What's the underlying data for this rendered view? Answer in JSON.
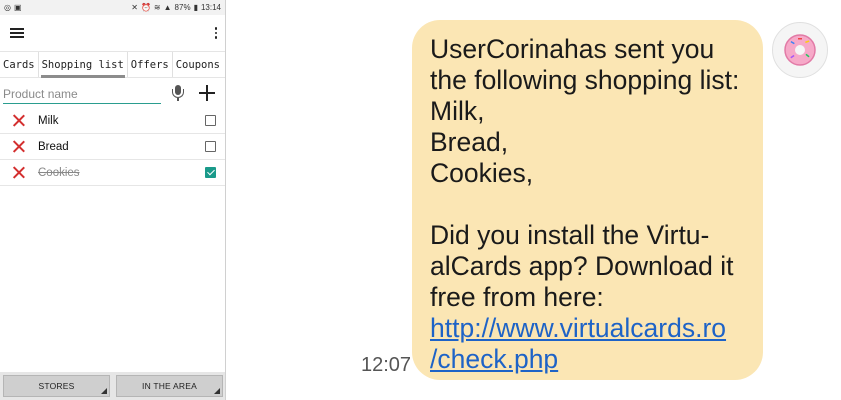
{
  "status_bar": {
    "battery": "87%",
    "time": "13:14"
  },
  "tabs": [
    {
      "label": "Cards"
    },
    {
      "label": "Shopping list"
    },
    {
      "label": "Offers"
    },
    {
      "label": "Coupons"
    }
  ],
  "input": {
    "placeholder": "Product name",
    "value": ""
  },
  "items": [
    {
      "name": "Milk",
      "checked": false
    },
    {
      "name": "Bread",
      "checked": false
    },
    {
      "name": "Cookies",
      "checked": true
    }
  ],
  "bottom_buttons": {
    "stores": "STORES",
    "in_the_area": "IN THE AREA"
  },
  "chat": {
    "time": "12:07",
    "message_text": "UserCorinahas sent you\nthe following shopping list:\nMilk,\nBread,\nCookies,\n\nDid you install the Virtu-\nalCards app? Download it\nfree from here:",
    "link_line1": "http://www.virtualcards.ro",
    "link_line2": "/check.php"
  },
  "colors": {
    "accent": "#2a9d8f",
    "delete": "#d32f2f",
    "checked": "#1a9a8a",
    "bubble": "#fbe6b4",
    "link": "#1e63c7"
  },
  "icons": [
    "menu-icon",
    "overflow-menu-icon",
    "microphone-icon",
    "plus-icon",
    "delete-icon",
    "checkbox-icon",
    "donut-avatar-icon"
  ]
}
